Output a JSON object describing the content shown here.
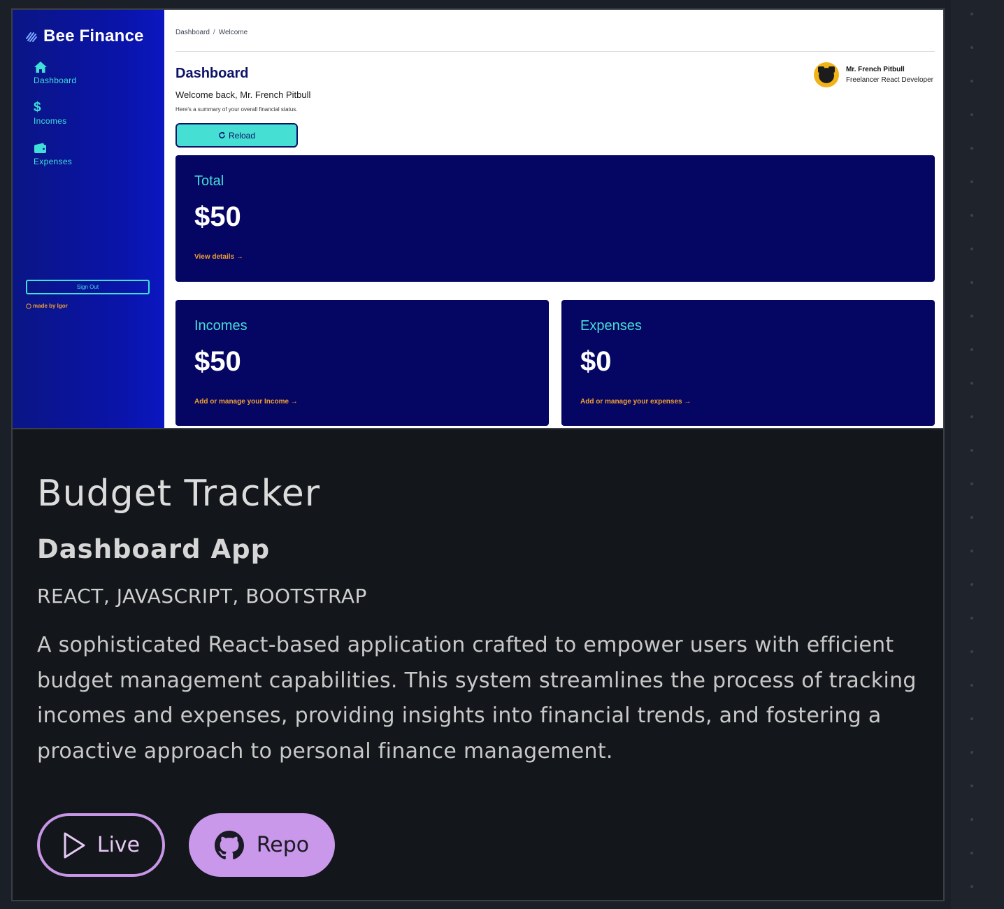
{
  "app": {
    "brand": "Bee Finance",
    "nav": [
      {
        "label": "Dashboard",
        "icon": "home-icon"
      },
      {
        "label": "Incomes",
        "icon": "dollar-icon"
      },
      {
        "label": "Expenses",
        "icon": "wallet-icon"
      }
    ],
    "sign_out": "Sign Out",
    "made_by": "made by Igor",
    "breadcrumb": [
      "Dashboard",
      "Welcome"
    ],
    "title": "Dashboard",
    "welcome": "Welcome back, Mr. French Pitbull",
    "summary": "Here's a summary of your overall financial status.",
    "reload": "Reload",
    "user": {
      "name": "Mr. French Pitbull",
      "role": "Freelancer React Developer"
    },
    "stats": {
      "total": {
        "label": "Total",
        "amount": "$50",
        "link": "View details →"
      },
      "incomes": {
        "label": "Incomes",
        "amount": "$50",
        "link": "Add or manage your Income →"
      },
      "expenses": {
        "label": "Expenses",
        "amount": "$0",
        "link": "Add or manage your expenses →"
      }
    },
    "colors": {
      "sidebar": "#0a14a8",
      "accent": "#45dfd4",
      "card": "#050564",
      "link": "#f0a030"
    }
  },
  "project": {
    "title": "Budget Tracker",
    "subtitle": "Dashboard App",
    "tech": "REACT, JAVASCRIPT, BOOTSTRAP",
    "description": "A sophisticated React-based application crafted to empower users with efficient budget management capabilities. This system streamlines the process of tracking incomes and expenses, providing insights into financial trends, and fostering a proactive approach to personal finance management.",
    "live_label": "Live",
    "repo_label": "Repo"
  }
}
